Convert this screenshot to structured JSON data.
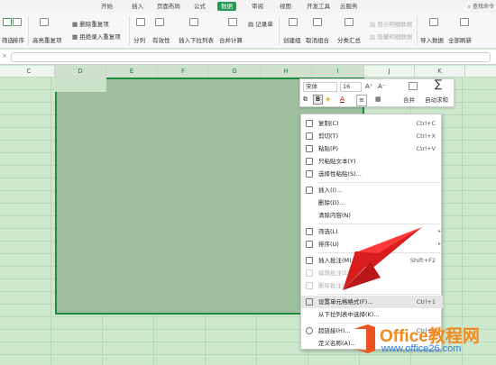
{
  "menu": {
    "tabs": [
      "开始",
      "插入",
      "页面布局",
      "公式",
      "数据",
      "审阅",
      "视图",
      "开发工具",
      "云服务"
    ],
    "active_tab": "数据",
    "search_label": "查找命令"
  },
  "ribbon": {
    "filter": "筛选",
    "sort": "排序",
    "highlight_dup": "高亮重复项",
    "delete_dup": "删除重复项",
    "reject_dup": "拒绝录入重复项",
    "text_to_col": "分列",
    "validity": "有效性",
    "dropdown": "插入下拉列表",
    "consolidate": "合并计算",
    "record": "记录单",
    "group": "创建组",
    "ungroup": "取消组合",
    "subtotal": "分类汇总",
    "show_detail": "显示明细数据",
    "hide_detail": "隐藏明细数据",
    "import": "导入数据",
    "refresh": "全部刷新"
  },
  "formula_bar": {
    "cancel_symbol": "×"
  },
  "columns": [
    "C",
    "D",
    "E",
    "F",
    "G",
    "H",
    "I",
    "J",
    "K"
  ],
  "mini_toolbar": {
    "font": "宋体",
    "size": "16",
    "bold": "B",
    "font_color": "A",
    "merge": "合并",
    "autosum": "自动求和",
    "sum_symbol": "∑"
  },
  "context_menu": [
    {
      "label": "复制(C)",
      "shortcut": "Ctrl+C",
      "icon": "copy-icon",
      "enabled": true
    },
    {
      "label": "剪切(T)",
      "shortcut": "Ctrl+X",
      "icon": "cut-icon",
      "enabled": true
    },
    {
      "label": "粘贴(P)",
      "shortcut": "Ctrl+V",
      "icon": "paste-icon",
      "enabled": true
    },
    {
      "label": "只粘贴文本(Y)",
      "shortcut": "",
      "icon": "paste-text-icon",
      "enabled": true
    },
    {
      "label": "选择性粘贴(S)...",
      "shortcut": "",
      "icon": "paste-special-icon",
      "enabled": true
    },
    {
      "label": "插入(I)...",
      "shortcut": "",
      "icon": "insert-icon",
      "enabled": true
    },
    {
      "label": "删除(D)...",
      "shortcut": "",
      "icon": "",
      "enabled": true
    },
    {
      "label": "清除内容(N)",
      "shortcut": "",
      "icon": "",
      "enabled": true
    },
    {
      "label": "筛选(L)",
      "shortcut": "",
      "icon": "filter-icon",
      "enabled": true,
      "submenu": true
    },
    {
      "label": "排序(U)",
      "shortcut": "",
      "icon": "sort-icon",
      "enabled": true,
      "submenu": true
    },
    {
      "label": "插入批注(M)...",
      "shortcut": "Shift+F2",
      "icon": "comment-icon",
      "enabled": true
    },
    {
      "label": "编辑批注(E)...",
      "shortcut": "",
      "icon": "edit-comment-icon",
      "enabled": false
    },
    {
      "label": "删除批注(M)",
      "shortcut": "",
      "icon": "delete-comment-icon",
      "enabled": false
    },
    {
      "label": "设置单元格格式(F)...",
      "shortcut": "Ctrl+1",
      "icon": "format-cells-icon",
      "enabled": true,
      "highlighted": true
    },
    {
      "label": "从下拉列表中选择(K)...",
      "shortcut": "",
      "icon": "",
      "enabled": true
    },
    {
      "label": "超链接(H)...",
      "shortcut": "Ctrl+K",
      "icon": "link-icon",
      "enabled": true
    },
    {
      "label": "定义名称(A)...",
      "shortcut": "",
      "icon": "",
      "enabled": true
    }
  ],
  "watermark": {
    "brand": "Office教程网",
    "url": "www.office26.com"
  },
  "colors": {
    "accent": "#1f9a4e",
    "arrow": "#e02020",
    "sheet_bg": "#cde8cd"
  }
}
